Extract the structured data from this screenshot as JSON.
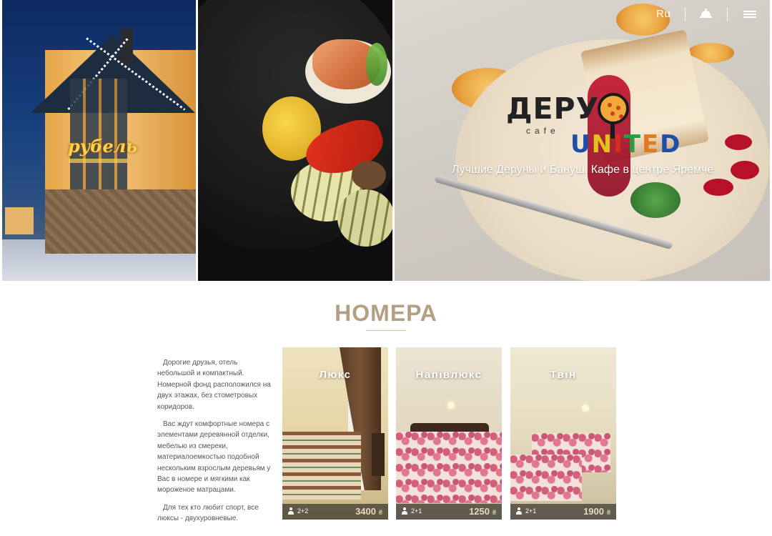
{
  "header": {
    "lang": "Ru",
    "bell_icon": "bell-icon",
    "menu_icon": "hamburger-menu-icon"
  },
  "hero": {
    "sign_text": "рубель",
    "logo": {
      "name": "ДЕРУН",
      "sub": "cafe",
      "united": [
        "U",
        "N",
        "I",
        "T",
        "E",
        "D"
      ],
      "united_colors": [
        "#1e4fa8",
        "#e3c21c",
        "#d4301f",
        "#2f9a45",
        "#e07a1f",
        "#1e4fa8"
      ]
    },
    "tagline": "Лучшие Деруны и Бануш. Кафе в центре Яремче"
  },
  "rooms": {
    "title": "НОМЕРА",
    "about": [
      "Дорогие друзья, отель небольшой и компактный. Номерной фонд расположился на двух этажах, без стометровых коридоров.",
      "Вас ждут комфортные номера с элементами деревянной отделки, мебелью из смереки, материалоемкостью подобной нескольким взрослым деревьям у Вас в номере и мягкими как мороженое матрацами.",
      "Для тех кто любит спорт, все люксы - двухуровневые."
    ],
    "cards": [
      {
        "title": "Люкс",
        "guests": "2+2",
        "price": "3400",
        "currency": "₴"
      },
      {
        "title": "Напівлюкс",
        "guests": "2+1",
        "price": "1250",
        "currency": "₴"
      },
      {
        "title": "Твін",
        "guests": "2+1",
        "price": "1900",
        "currency": "₴"
      }
    ]
  },
  "colors": {
    "accent": "#b49e84",
    "price": "#e9d9be"
  }
}
